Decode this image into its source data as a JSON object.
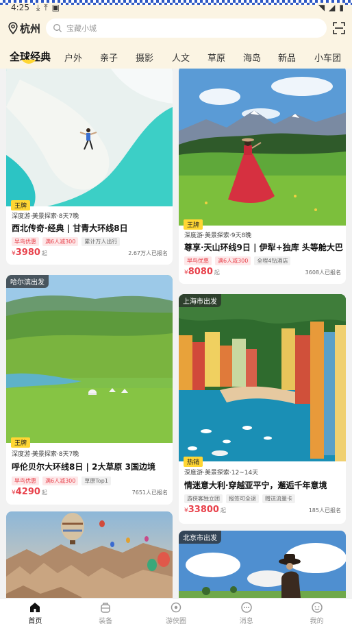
{
  "status_bar": {
    "time": "4:25"
  },
  "header": {
    "city": "杭州",
    "search_placeholder": "宝藏小城"
  },
  "tabs": [
    "全球经典",
    "户外",
    "亲子",
    "摄影",
    "人文",
    "草原",
    "海岛",
    "新品",
    "小车团"
  ],
  "cards": [
    {
      "badge": "王牌",
      "meta": "深度游·美景探索·8天7晚",
      "title": "西北传奇·经典 | 甘青大环线8日",
      "chips": [
        "早鸟优惠",
        "满6人减300",
        "累计万人出行"
      ],
      "currency": "¥",
      "price": "3980",
      "price_suffix": "起",
      "signup": "2.67万人已报名"
    },
    {
      "ribbon": "哈尔滨出发",
      "badge": "王牌",
      "meta": "深度游·美景探索·8天7晚",
      "title": "呼伦贝尔大环线8日 | 2大草原 3国边境",
      "chips": [
        "早鸟优惠",
        "满6人减300",
        "草原Top1"
      ],
      "currency": "¥",
      "price": "4290",
      "price_suffix": "起",
      "signup": "7651人已报名"
    },
    {
      "badge": "王牌",
      "meta": "深度游·美景探索·9天8晚",
      "title": "尊享·天山环线9日 | 伊犁+独库 头等舱大巴",
      "chips": [
        "早鸟优惠",
        "满6人减300",
        "全程4钻酒店"
      ],
      "currency": "¥",
      "price": "8080",
      "price_suffix": "起",
      "signup": "3608人已报名"
    },
    {
      "ribbon": "上海市出发",
      "badge": "热销",
      "meta": "深度游·美景探索·12~14天",
      "title": "情迷意大利·穿越亚平宁，邂逅千年意境",
      "chips": [
        "游侠客独立团",
        "报签可全退",
        "赠送流量卡"
      ],
      "currency": "¥",
      "price": "33800",
      "price_suffix": "起",
      "signup": "185人已报名"
    },
    {
      "ribbon": ""
    },
    {
      "ribbon": "北京市出发"
    }
  ],
  "bottom_nav": [
    "首页",
    "装备",
    "游侠圈",
    "消息",
    "我的"
  ],
  "colors": {
    "accent": "#e8414b",
    "badge": "#ffd633",
    "header_bg": "#fbf4e3"
  }
}
